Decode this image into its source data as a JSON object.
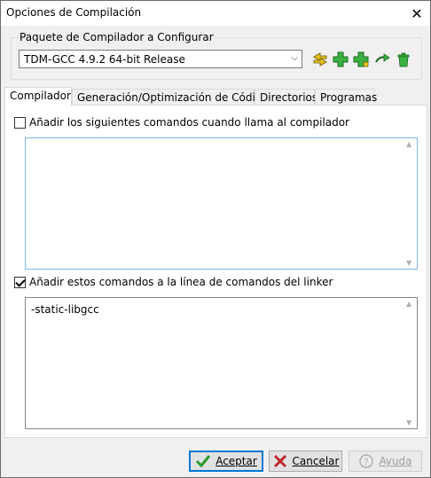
{
  "window": {
    "title": "Opciones de Compilación",
    "close_glyph": "✕"
  },
  "compiler_package": {
    "label": "Paquete de Compilador a Configurar",
    "selected": "TDM-GCC 4.9.2 64-bit Release",
    "arrow_glyph": "⌵"
  },
  "toolbar": {
    "icons": [
      "find-compilers-icon",
      "add-empty-icon",
      "add-folder-icon",
      "rename-icon",
      "delete-trash-icon"
    ]
  },
  "tabs": [
    {
      "label": "Compilador",
      "active": true
    },
    {
      "label": "Generación/Optimización de Código",
      "active": false
    },
    {
      "label": "Directorios",
      "active": false
    },
    {
      "label": "Programas",
      "active": false
    }
  ],
  "compiler_tab": {
    "compiler_cmd_checkbox": {
      "label": "Añadir los siguientes comandos cuando llama al compilador",
      "checked": false
    },
    "compiler_cmd_text": "",
    "linker_cmd_checkbox": {
      "label": "Añadir estos comandos a la línea de comandos del linker",
      "checked": true
    },
    "linker_cmd_text": "-static-libgcc"
  },
  "buttons": {
    "ok": "Aceptar",
    "cancel": "Cancelar",
    "help": "Ayuda"
  },
  "colors": {
    "accent": "#0078d7",
    "ok_check": "#2a9a2a",
    "cancel_x": "#c0262c",
    "add_green": "#3cb043"
  }
}
